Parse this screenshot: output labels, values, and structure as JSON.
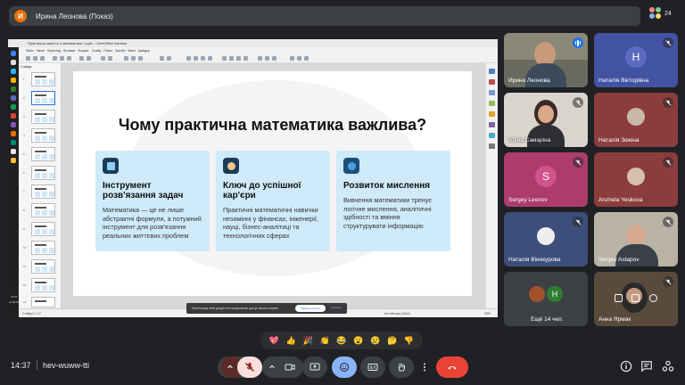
{
  "meeting": {
    "presenter_label": "Ирина Леонова (Показ)",
    "presenter_initial": "И",
    "participant_count": "24",
    "time": "14:37",
    "code": "hev-wuww-tti"
  },
  "shared_screen": {
    "window_title": "Практична заняття з математики 1.pptx - LibreOffice Impress",
    "menu": [
      "Файл",
      "Зміни",
      "Перегляд",
      "Вставка",
      "Формат",
      "Слайд",
      "Показ",
      "Засоби",
      "Вікно",
      "Довідка"
    ],
    "slides_panel_label": "Слайди",
    "slide_numbers": [
      "1",
      "2",
      "3",
      "4",
      "5",
      "6",
      "7",
      "8",
      "9",
      "10",
      "11",
      "12",
      "13"
    ],
    "status_left": "Слайд 2 з 17",
    "status_right": "Англійська (США)",
    "zoom": "93%",
    "taskbar_time": "14:37",
    "taskbar_date": "11.03.2025",
    "notification_text": "Презентація meet.google.com представляє доступ вашого екрана.",
    "notification_button": "Закрити доступ",
    "notification_link": "Сховати",
    "slide": {
      "title": "Чому практична математика важлива?",
      "cards": [
        {
          "heading": "Інструмент розв'язання задач",
          "body": "Математика — це не лише абстрактні формули, а потужний інструмент для розв'язання реальних життєвих проблем",
          "icon": "calculator-icon"
        },
        {
          "heading": "Ключ до успішної кар'єри",
          "body": "Практичні математичні навички незамінні у фінансах, інженерії, науці, бізнес-аналітиці та технологічних сферах",
          "icon": "building-icon"
        },
        {
          "heading": "Розвиток мислення",
          "body": "Вивчення математики тренує логічне мислення, аналітичні здібності та вміння структурувати інформацію",
          "icon": "brain-icon"
        }
      ]
    }
  },
  "participants": [
    {
      "name": "Ирина Леонова",
      "state": "speaking"
    },
    {
      "name": "Наталія Вікторівна",
      "initial": "Н",
      "color": "#4353a3",
      "state": "muted"
    },
    {
      "name": "Аліна Самаріна",
      "state": "muted"
    },
    {
      "name": "Наталія Зюкіна",
      "state": "muted"
    },
    {
      "name": "Sergey Leonov",
      "initial": "S",
      "color": "#ad3b6e",
      "state": "muted"
    },
    {
      "name": "Anzhela Yeskova",
      "state": "muted"
    },
    {
      "name": "Наталія Вінокурова",
      "state": "muted"
    },
    {
      "name": "Sergey Astapov",
      "state": "muted"
    },
    {
      "name": "Ещё 14 чел.",
      "initial": "Н",
      "color": "#2e7d32"
    },
    {
      "name": "Анна Ярмак",
      "state": "muted"
    }
  ],
  "reactions": [
    "💖",
    "👍",
    "🎉",
    "👏",
    "😂",
    "😮",
    "😢",
    "🤔",
    "👎"
  ],
  "colors": {
    "end_call": "#ea4335",
    "accent": "#8ab4f8",
    "card": "#cfeaf9",
    "mic_off": "#f9dedc"
  }
}
